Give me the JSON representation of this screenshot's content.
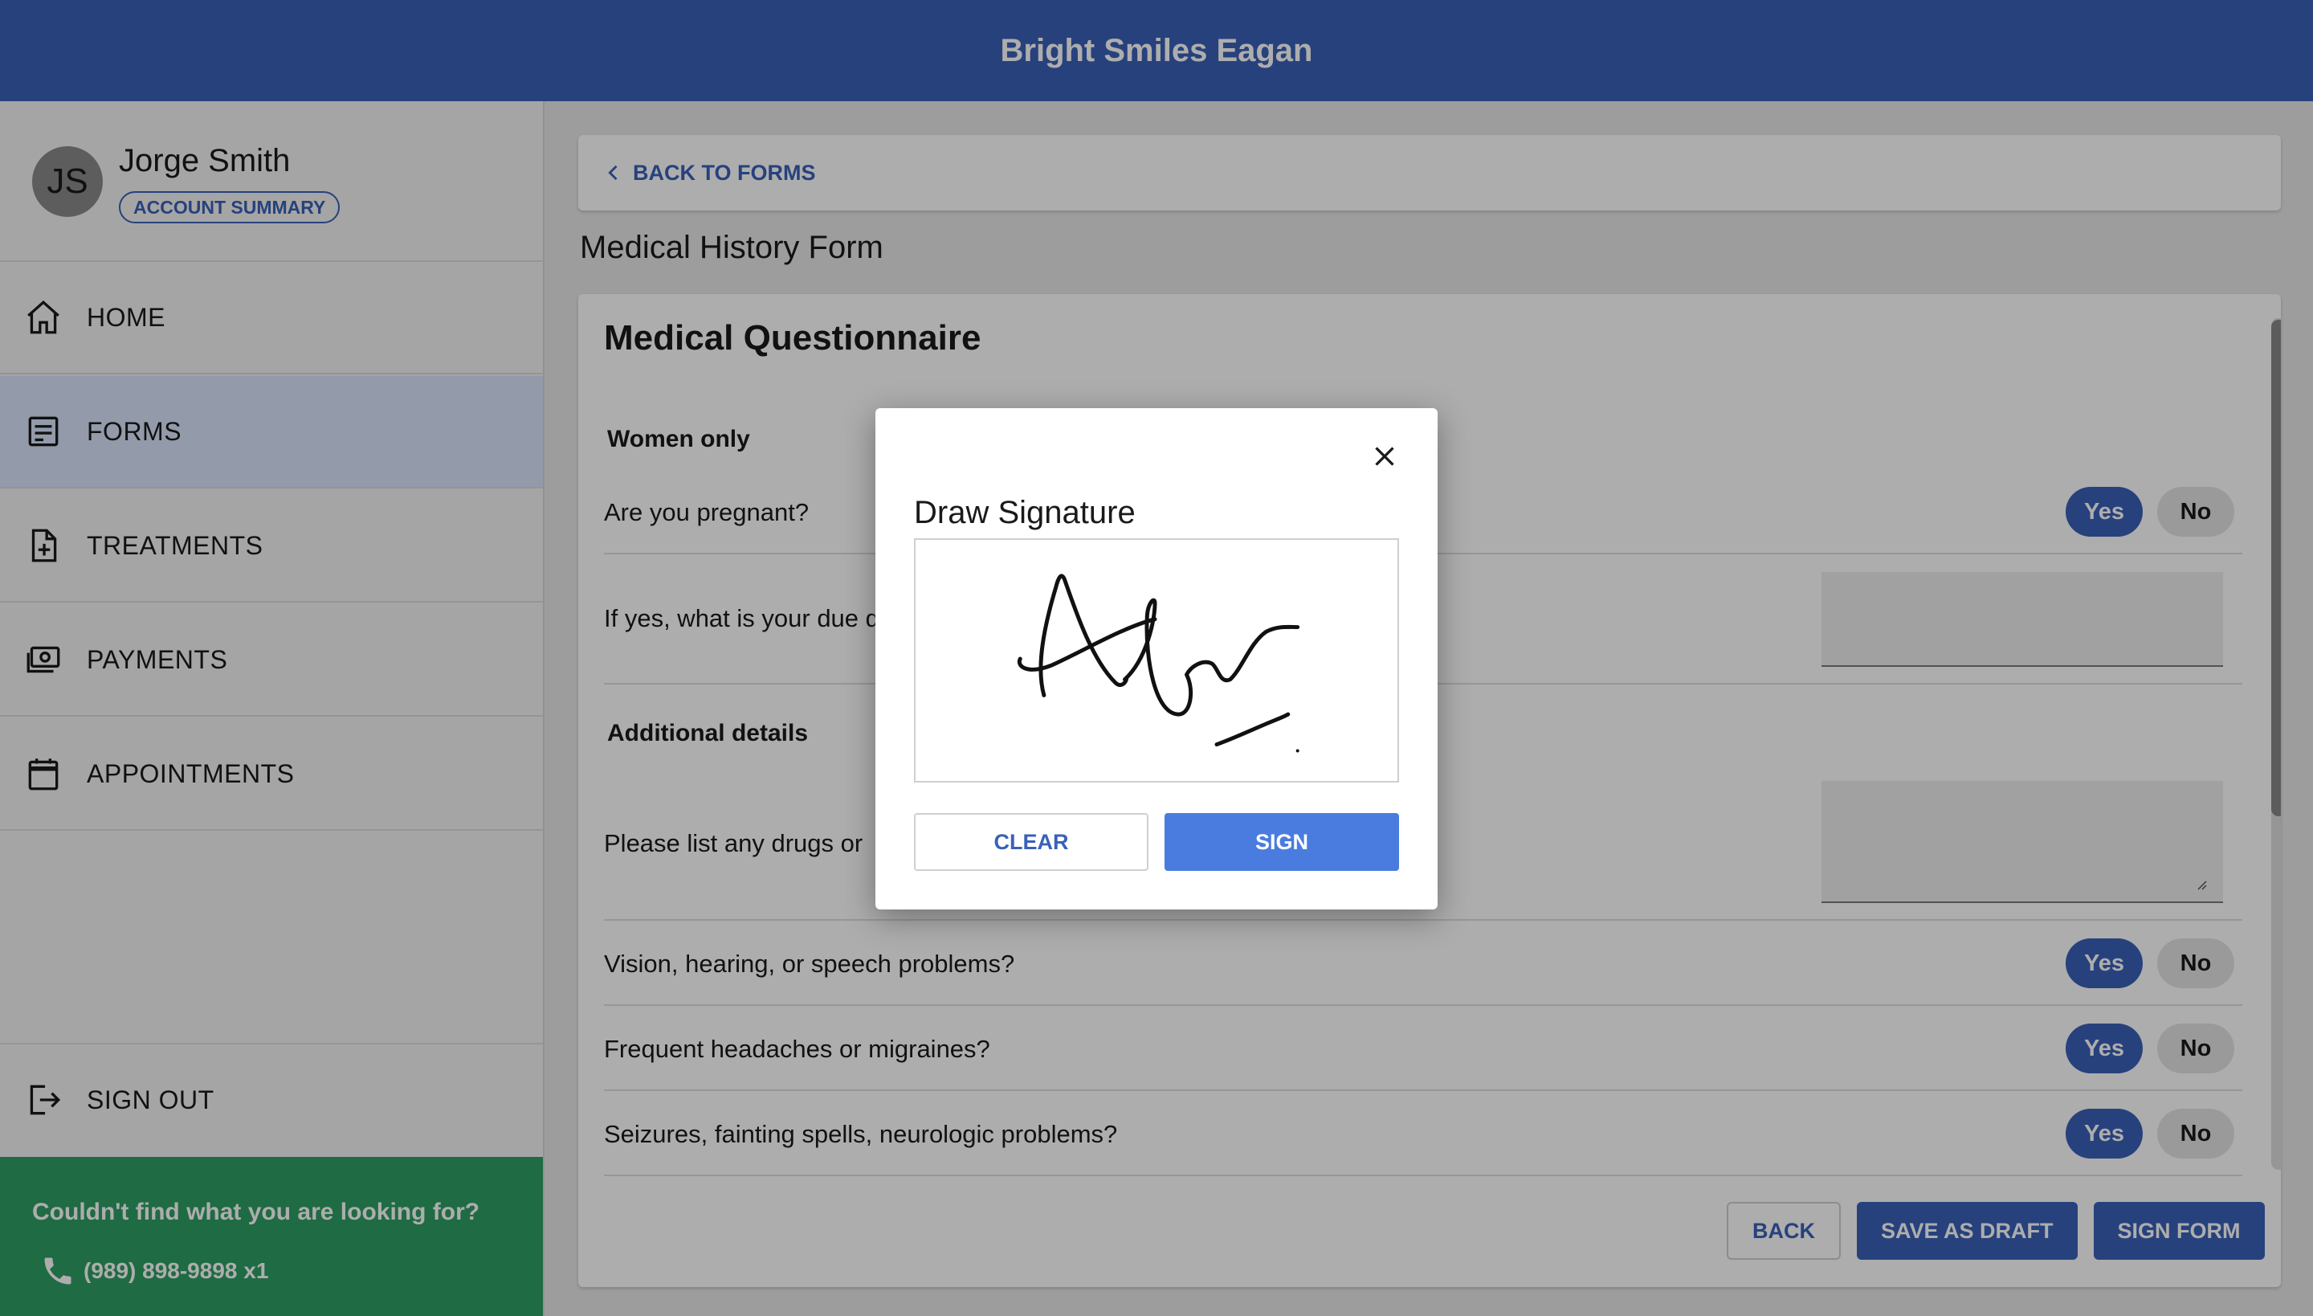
{
  "header": {
    "title": "Bright Smiles Eagan"
  },
  "account": {
    "initials": "JS",
    "name": "Jorge Smith",
    "summary_label": "ACCOUNT SUMMARY"
  },
  "sidebar": {
    "items": [
      {
        "label": "HOME",
        "icon": "home-icon"
      },
      {
        "label": "FORMS",
        "icon": "forms-icon",
        "active": true
      },
      {
        "label": "TREATMENTS",
        "icon": "treatments-icon"
      },
      {
        "label": "PAYMENTS",
        "icon": "payments-icon"
      },
      {
        "label": "APPOINTMENTS",
        "icon": "calendar-icon"
      }
    ],
    "signout_label": "SIGN OUT"
  },
  "help": {
    "text": "Couldn't find what you are looking for?",
    "phone": "(989) 898-9898 x1"
  },
  "main": {
    "back_label": "BACK TO FORMS",
    "form_title": "Medical History Form",
    "questionnaire_title": "Medical Questionnaire",
    "sections": {
      "women_only": "Women only",
      "additional": "Additional details"
    },
    "questions": {
      "pregnant": "Are you pregnant?",
      "due_date": "If yes, what is your due d",
      "drugs": "Please list any drugs or",
      "vision": "Vision, hearing, or speech problems?",
      "headaches": "Frequent headaches or migraines?",
      "seizures": "Seizures, fainting spells, neurologic problems?"
    },
    "yes_label": "Yes",
    "no_label": "No",
    "buttons": {
      "back": "BACK",
      "save_draft": "SAVE AS DRAFT",
      "sign_form": "SIGN FORM"
    }
  },
  "modal": {
    "title": "Draw Signature",
    "clear_label": "CLEAR",
    "sign_label": "SIGN"
  },
  "colors": {
    "primary": "#3a61b8",
    "help_bg": "#2e9e63",
    "sign_button": "#4a7ce0"
  }
}
